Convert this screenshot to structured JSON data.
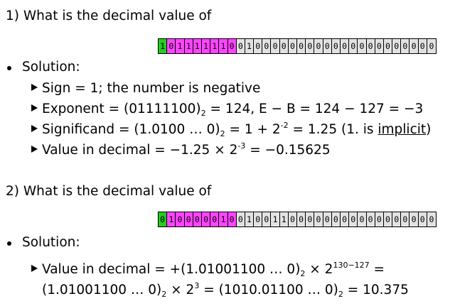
{
  "q1": {
    "title": "1) What is the decimal value of",
    "bits": "10111111001000000000000000000000",
    "solution_label": "Solution:",
    "sign_line": "Sign = 1; the number is negative",
    "exp_pre": "Exponent = (01111100)",
    "exp_sub": "2",
    "exp_post": " = 124, E − B = 124 − 127 = −3",
    "sig_pre": "Significand = (1.0100 … 0)",
    "sig_sub": "2",
    "sig_mid": " = 1 + 2",
    "sig_sup": "-2",
    "sig_mid2": " = 1.25 (1. is ",
    "sig_implicit": "implicit",
    "sig_end": ")",
    "val_pre": "Value in decimal = −1.25 × 2",
    "val_sup": "-3",
    "val_post": " = −0.15625"
  },
  "q2": {
    "title": "2) What is the decimal value of",
    "bits": "01000001001001100000000000000000",
    "solution_label": "Solution:",
    "l1_pre": "Value in decimal = +(1.01001100 … 0)",
    "l1_sub": "2",
    "l1_mid": " × 2",
    "l1_sup": "130−127",
    "l1_post": " =",
    "l2_pre": "(1.01001100 … 0)",
    "l2_sub": "2",
    "l2_mid": " × 2",
    "l2_sup": "3",
    "l2_mid2": " = (1010.01100 … 0)",
    "l2_sub2": "2",
    "l2_post": " =  10.375"
  },
  "colors": {
    "sign": "#22cc22",
    "exponent": "#ff44ff",
    "significand": "#e2e2e2"
  }
}
